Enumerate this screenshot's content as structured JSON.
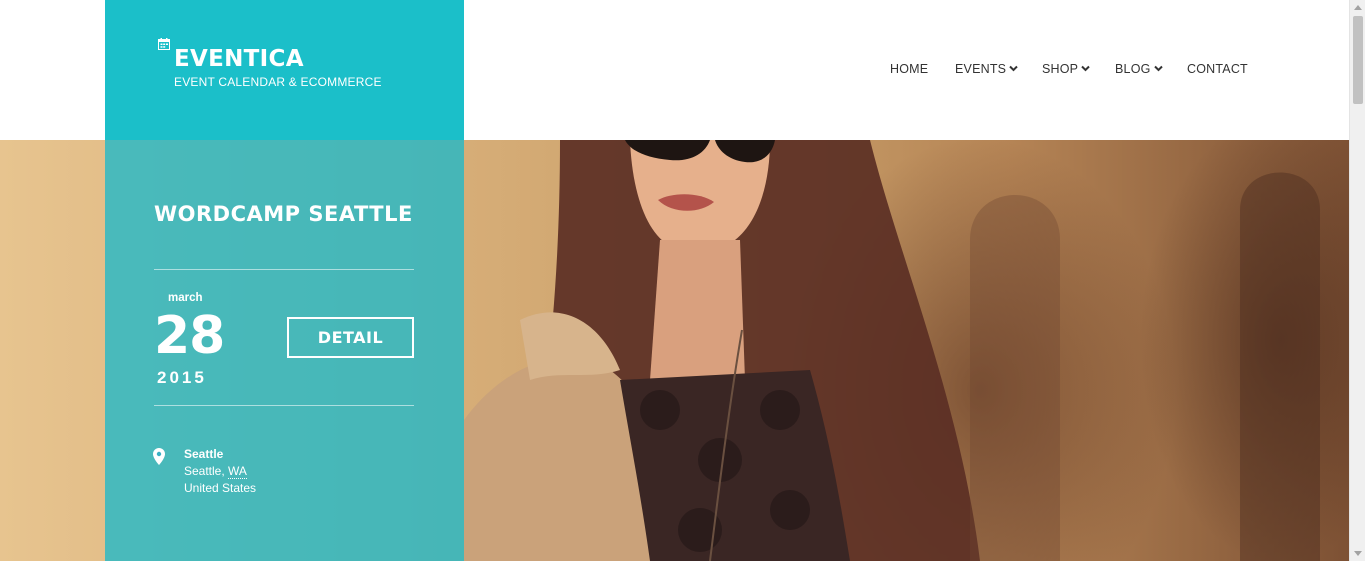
{
  "brand": {
    "title": "EVENTICA",
    "subtitle": "EVENT CALENDAR & ECOMMERCE",
    "icon": "calendar-icon",
    "accent_color": "#1bbfc9"
  },
  "nav": {
    "items": [
      {
        "label": "HOME",
        "has_dropdown": false
      },
      {
        "label": "EVENTS",
        "has_dropdown": true
      },
      {
        "label": "SHOP",
        "has_dropdown": true
      },
      {
        "label": "BLOG",
        "has_dropdown": true
      },
      {
        "label": "CONTACT",
        "has_dropdown": false
      }
    ]
  },
  "event": {
    "title": "WORDCAMP SEATTLE",
    "month": "march",
    "day": "28",
    "year": "2015",
    "detail_label": "DETAIL",
    "location": {
      "name": "Seattle",
      "city": "Seattle, ",
      "state": "WA",
      "country": "United States",
      "icon": "map-pin-icon"
    }
  }
}
